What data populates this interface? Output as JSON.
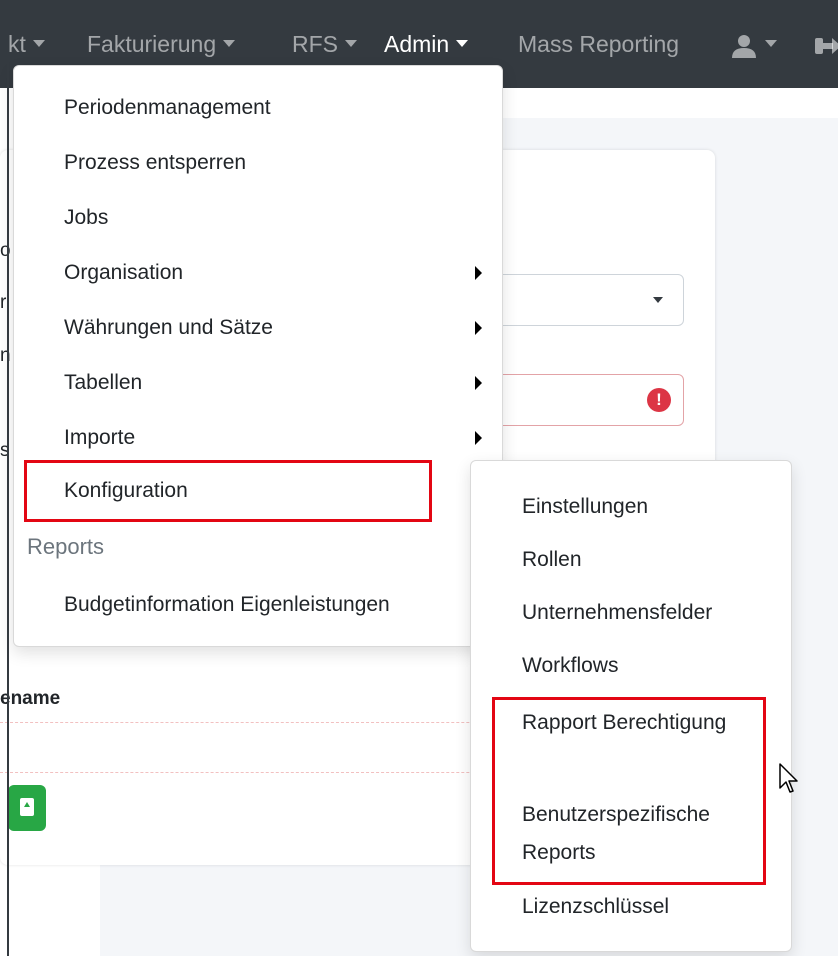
{
  "navbar": {
    "items": [
      {
        "label": "kt",
        "has_caret": true
      },
      {
        "label": "Fakturierung",
        "has_caret": true
      },
      {
        "label": "RFS",
        "has_caret": true
      },
      {
        "label": "Admin",
        "has_caret": true,
        "active": true
      },
      {
        "label": "Mass Reporting",
        "has_caret": false
      }
    ],
    "user_icon": "user-icon",
    "logout_icon": "logout-icon"
  },
  "admin_menu": {
    "items": [
      {
        "label": "Periodenmanagement"
      },
      {
        "label": "Prozess entsperren"
      },
      {
        "label": "Jobs"
      },
      {
        "label": "Organisation",
        "submenu": true
      },
      {
        "label": "Währungen und Sätze",
        "submenu": true
      },
      {
        "label": "Tabellen",
        "submenu": true
      },
      {
        "label": "Importe",
        "submenu": true
      },
      {
        "label": "Konfiguration",
        "highlighted": true
      }
    ],
    "reports_header": "Reports",
    "reports_items": [
      {
        "label": "Budgetinformation Eigenleistungen"
      }
    ]
  },
  "config_submenu": {
    "items": [
      {
        "label": "Einstellungen"
      },
      {
        "label": "Rollen"
      },
      {
        "label": "Unternehmensfelder"
      },
      {
        "label": "Workflows"
      },
      {
        "label": "Rapport Berechtigung",
        "highlighted": true
      },
      {
        "label": "Benutzerspezifische Reports",
        "highlighted": true
      },
      {
        "label": "Lizenzschlüssel"
      }
    ]
  },
  "background": {
    "column_header": "ename",
    "fragments": [
      "o",
      "r",
      "n",
      "s"
    ]
  },
  "colors": {
    "navbar_bg": "#343a40",
    "highlight_red": "#e30613",
    "error_red": "#dc3545",
    "success_green": "#28a745"
  }
}
